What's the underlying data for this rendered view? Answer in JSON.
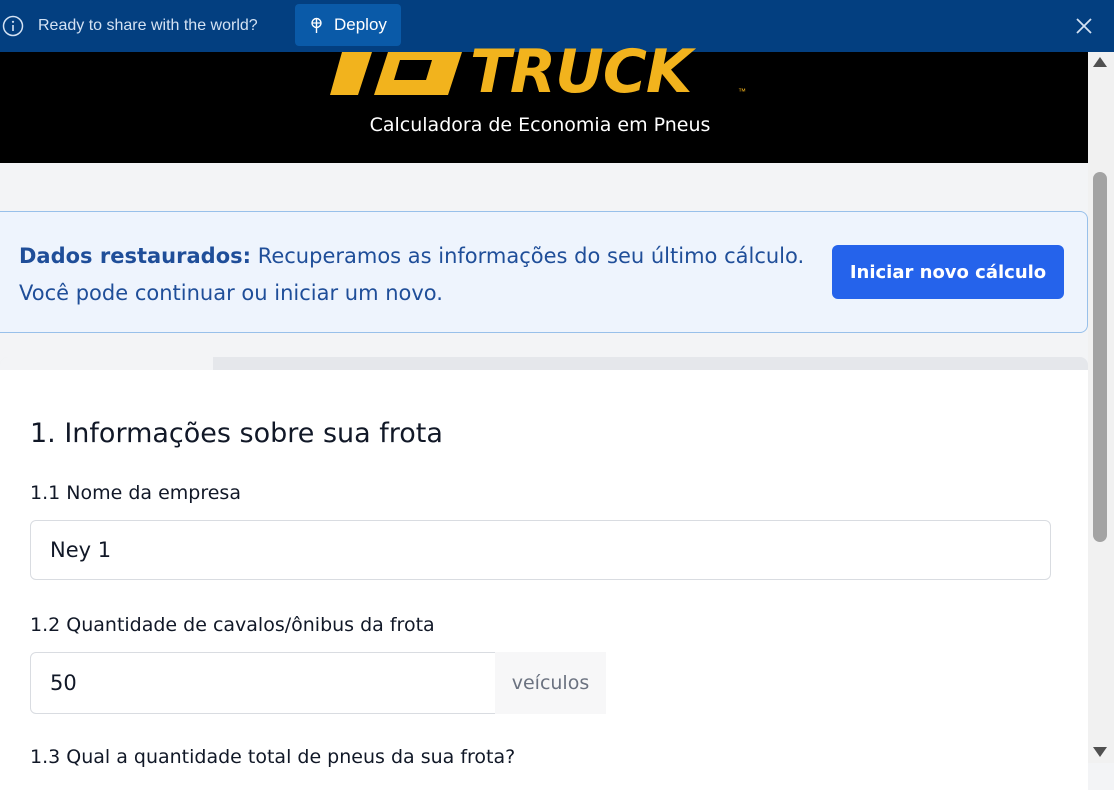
{
  "deploy_bar": {
    "message": "Ready to share with the world?",
    "deploy_label": "Deploy"
  },
  "header": {
    "logo_text": "TRUCK",
    "logo_mark": "™",
    "subtitle": "Calculadora de Economia em Pneus"
  },
  "notice": {
    "bold": "Dados restaurados:",
    "text": " Recuperamos as informações do seu último cálculo. Você pode continuar ou iniciar um novo.",
    "button_label": "Iniciar novo cálculo"
  },
  "progress": {
    "fraction": 0.196
  },
  "form": {
    "section_title": "1. Informações sobre sua frota",
    "company_label": "1.1 Nome da empresa",
    "company_value": "Ney 1",
    "vehicles_label": "1.2 Quantidade de cavalos/ônibus da frota",
    "vehicles_value": "50",
    "vehicles_unit": "veículos",
    "tires_label": "1.3 Qual a quantidade total de pneus da sua frota?"
  },
  "colors": {
    "deploy_bar": "#033f80",
    "brand_yellow": "#f2b31d",
    "primary_button": "#2563eb",
    "notice_text": "#1f4e99"
  },
  "icons": [
    "info-icon",
    "deploy-icon",
    "close-icon",
    "scroll-up-icon",
    "scroll-down-icon"
  ]
}
